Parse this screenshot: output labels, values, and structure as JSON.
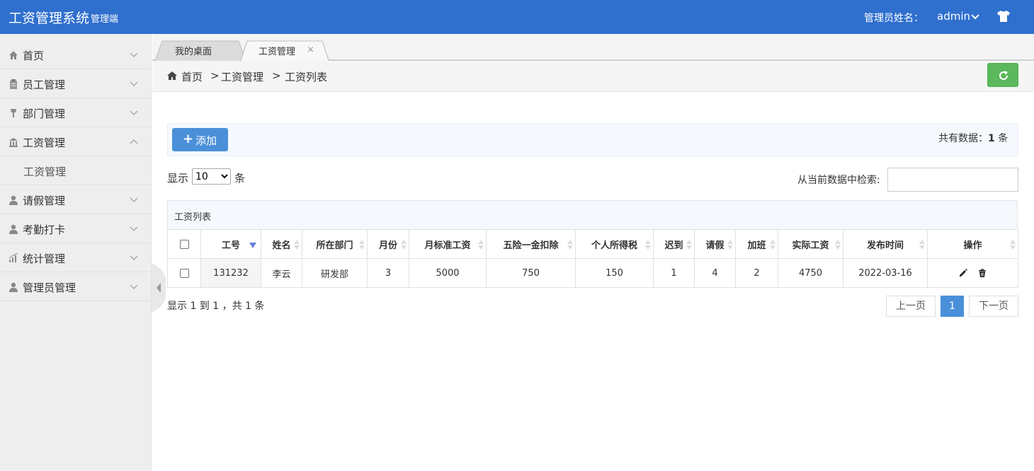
{
  "header": {
    "title": "工资管理系统",
    "subtitle": "管理端",
    "admin_label": "管理员姓名：",
    "admin_name": "admin"
  },
  "sidebar": {
    "items": [
      {
        "label": "首页",
        "icon": "home-icon"
      },
      {
        "label": "员工管理",
        "icon": "clipboard-icon"
      },
      {
        "label": "部门管理",
        "icon": "pin-icon"
      },
      {
        "label": "工资管理",
        "icon": "bank-icon"
      },
      {
        "label": "请假管理",
        "icon": "user-icon"
      },
      {
        "label": "考勤打卡",
        "icon": "user-icon"
      },
      {
        "label": "统计管理",
        "icon": "bar-chart-icon"
      },
      {
        "label": "管理员管理",
        "icon": "user-icon"
      }
    ],
    "sub_item": "工资管理"
  },
  "tabs": [
    {
      "label": "我的桌面"
    },
    {
      "label": "工资管理",
      "close": "×"
    }
  ],
  "breadcrumb": {
    "home": "首页",
    "sep1": ">",
    "level1": "工资管理",
    "sep2": ">",
    "level2": "工资列表"
  },
  "toolbar": {
    "add_label": "添加",
    "total_prefix": "共有数据：",
    "total_count": "1",
    "total_suffix": "条"
  },
  "length": {
    "prefix": "显示",
    "value": "10",
    "suffix": "条"
  },
  "search": {
    "label": "从当前数据中检索:",
    "value": ""
  },
  "table": {
    "title": "工资列表",
    "columns": [
      "工号",
      "姓名",
      "所在部门",
      "月份",
      "月标准工资",
      "五险一金扣除",
      "个人所得税",
      "迟到",
      "请假",
      "加班",
      "实际工资",
      "发布时间",
      "操作"
    ],
    "rows": [
      [
        "131232",
        "李云",
        "研发部",
        "3",
        "5000",
        "750",
        "150",
        "1",
        "4",
        "2",
        "4750",
        "2022-03-16"
      ]
    ]
  },
  "footer": {
    "info": "显示 1 到 1 ，共 1 条",
    "prev": "上一页",
    "current": "1",
    "next": "下一页"
  },
  "colors": {
    "header_bg": "#2f6fce",
    "primary": "#4a90d9",
    "success": "#5cb85c"
  }
}
